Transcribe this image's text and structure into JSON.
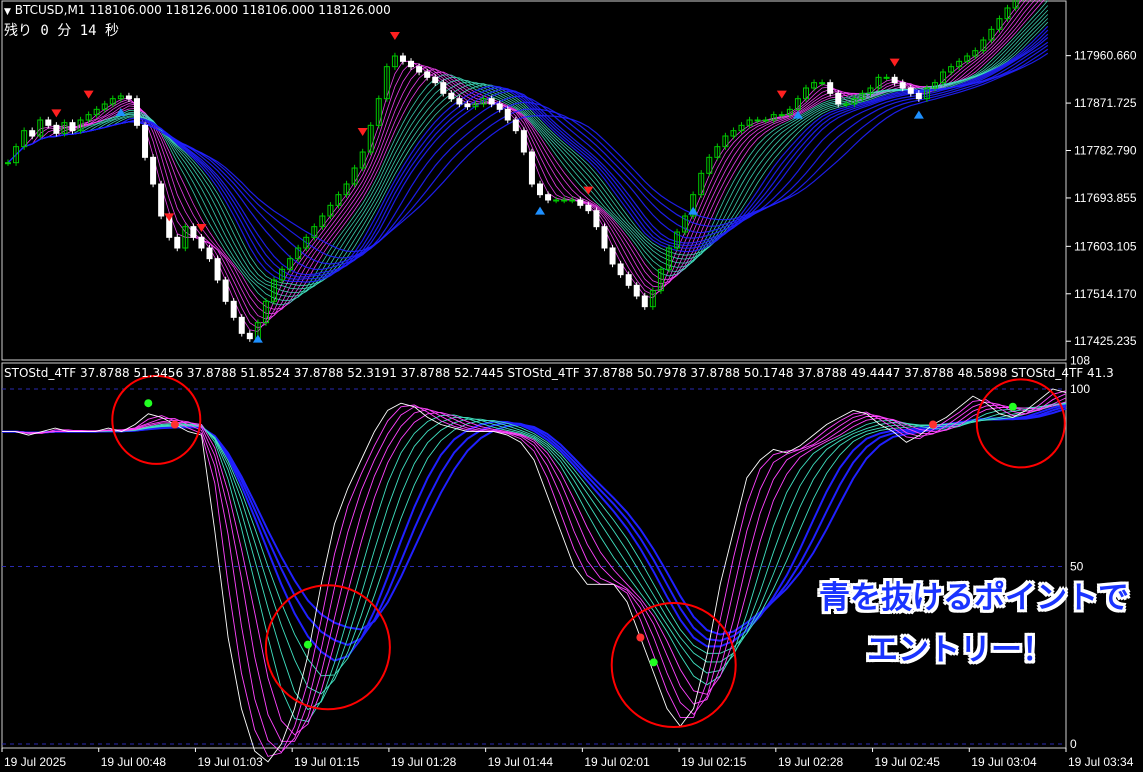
{
  "header": {
    "symbol": "BTCUSD,M1",
    "ohlc": "118106.000 118126.000 118106.000 118126.000",
    "countdown": "残り 0 分 14 秒"
  },
  "indicator": {
    "label": "STOStd_4TF 37.8788 51.3456 37.8788 51.8524 37.8788 52.3191 37.8788 52.7445   STOStd_4TF 37.8788 50.7978 37.8788 50.1748 37.8788 49.4447 37.8788 48.5898   STOStd_4TF 41.3"
  },
  "callout": {
    "line1": "青を抜けるポイントで",
    "line2": "エントリー！"
  },
  "colors": {
    "background": "#000000",
    "bull_candle": "#00c800",
    "bear_candle": "#ffffff",
    "axis": "#ffffff",
    "ma_fast": "#ff44ff",
    "ma_mid": "#40e0c0",
    "ma_slow": "#2020ff",
    "sell_arrow": "#ff2020",
    "buy_arrow": "#1e90ff",
    "circle": "#ff0000"
  },
  "chart_data": [
    {
      "type": "candlestick",
      "title": "BTCUSD,M1",
      "price_ticks": [
        "117960.660",
        "117871.725",
        "117782.790",
        "117693.855",
        "117603.105",
        "117514.170",
        "117425.235"
      ],
      "ylim": [
        117390,
        118050
      ],
      "x_ticks": [
        "19 Jul 2025",
        "19 Jul 00:48",
        "19 Jul 01:03",
        "19 Jul 01:15",
        "19 Jul 01:28",
        "19 Jul 01:44",
        "19 Jul 02:01",
        "19 Jul 02:15",
        "19 Jul 02:28",
        "19 Jul 02:45",
        "19 Jul 03:04",
        "19 Jul 03:34"
      ],
      "close": [
        117760,
        117790,
        117820,
        117810,
        117840,
        117830,
        117815,
        117835,
        117820,
        117840,
        117850,
        117860,
        117870,
        117880,
        117885,
        117880,
        117830,
        117770,
        117720,
        117660,
        117620,
        117600,
        117640,
        117620,
        117600,
        117580,
        117540,
        117500,
        117470,
        117440,
        117430,
        117460,
        117500,
        117540,
        117560,
        117580,
        117600,
        117620,
        117640,
        117660,
        117680,
        117700,
        117720,
        117750,
        117780,
        117830,
        117880,
        117940,
        117960,
        117950,
        117940,
        117930,
        117920,
        117910,
        117890,
        117880,
        117870,
        117865,
        117870,
        117880,
        117870,
        117860,
        117840,
        117820,
        117780,
        117720,
        117700,
        117690,
        117690,
        117690,
        117690,
        117680,
        117670,
        117640,
        117600,
        117570,
        117550,
        117530,
        117510,
        117490,
        117520,
        117560,
        117600,
        117630,
        117660,
        117700,
        117740,
        117770,
        117790,
        117810,
        117820,
        117830,
        117840,
        117840,
        117840,
        117850,
        117850,
        117860,
        117880,
        117900,
        117910,
        117910,
        117890,
        117870,
        117870,
        117880,
        117890,
        117900,
        117920,
        117920,
        117910,
        117900,
        117890,
        117880,
        117900,
        117910,
        117930,
        117940,
        117950,
        117960,
        117970,
        117990,
        118010,
        118030,
        118050,
        118070,
        118090,
        118100,
        118110,
        118126
      ],
      "markers": {
        "sell": [
          6,
          10,
          20,
          24,
          44,
          48,
          72,
          96,
          110
        ],
        "buy": [
          14,
          31,
          66,
          85,
          98,
          113
        ]
      }
    },
    {
      "type": "line",
      "title": "STOStd_4TF",
      "ylim": [
        0,
        100
      ],
      "y_ticks": [
        "108",
        "100",
        "50",
        "0"
      ],
      "levels": [
        100,
        50,
        0
      ],
      "series": [
        {
          "values": [
            88,
            88,
            87,
            88,
            89,
            88,
            88,
            88,
            89,
            88,
            90,
            93,
            92,
            90,
            88,
            87,
            60,
            30,
            10,
            -2,
            -5,
            0,
            10,
            25,
            45,
            62,
            72,
            80,
            88,
            94,
            96,
            95,
            92,
            90,
            89,
            88,
            88,
            88,
            87,
            85,
            80,
            70,
            60,
            50,
            45,
            45,
            45,
            40,
            30,
            20,
            10,
            5,
            10,
            25,
            45,
            60,
            75,
            80,
            83,
            82,
            84,
            87,
            90,
            92,
            94,
            93,
            90,
            88,
            85,
            87,
            90,
            92,
            95,
            98,
            96,
            93,
            92,
            94,
            97,
            100,
            99
          ]
        }
      ],
      "entry_points": [
        11,
        23,
        49,
        76
      ]
    }
  ]
}
